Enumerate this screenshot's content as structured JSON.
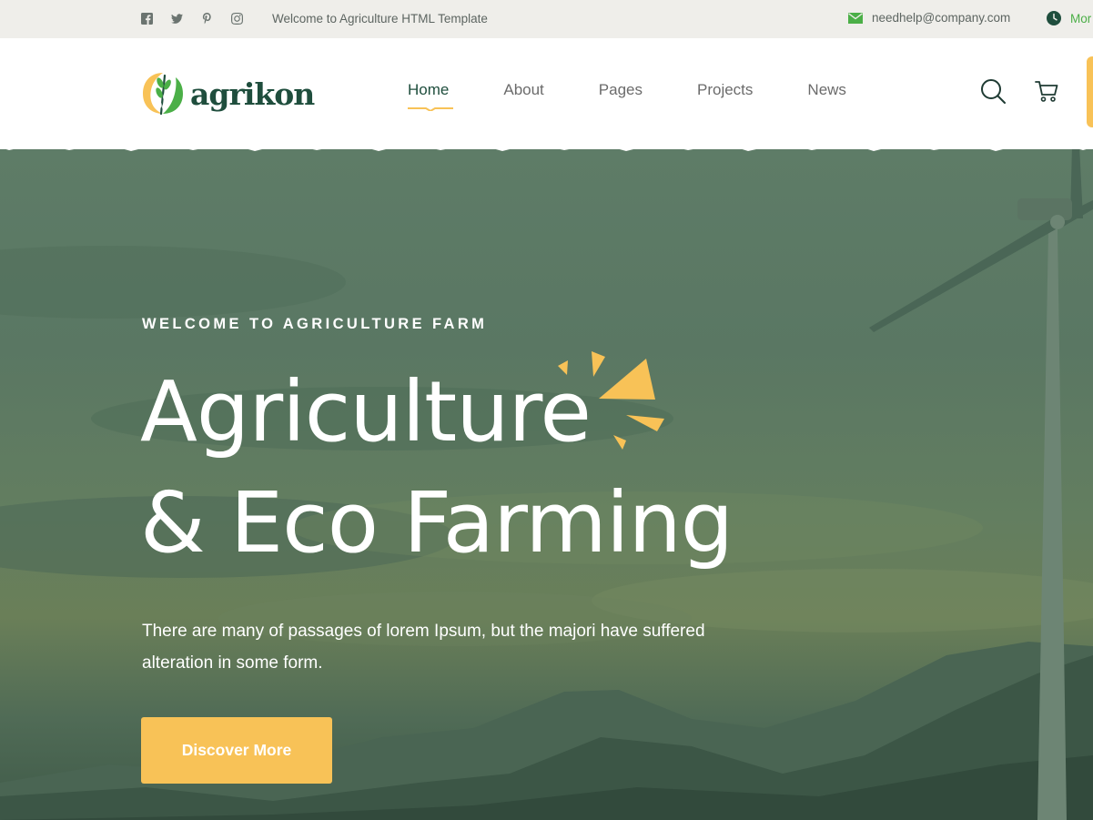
{
  "topbar": {
    "social_icons": [
      "facebook-icon",
      "twitter-icon",
      "pinterest-icon",
      "instagram-icon"
    ],
    "welcome": "Welcome to Agriculture HTML Template",
    "email": "needhelp@company.com",
    "hours_partial": "Mor"
  },
  "header": {
    "logo_text": "agrikon",
    "nav": [
      {
        "label": "Home",
        "active": true
      },
      {
        "label": "About",
        "active": false
      },
      {
        "label": "Pages",
        "active": false
      },
      {
        "label": "Projects",
        "active": false
      },
      {
        "label": "News",
        "active": false
      }
    ],
    "icons": [
      "search-icon",
      "cart-icon"
    ]
  },
  "hero": {
    "eyebrow": "WELCOME TO AGRICULTURE FARM",
    "headline_line1": "Agriculture",
    "headline_line2": "& Eco Farming",
    "description": "There are many of passages of lorem Ipsum, but the majori have suffered alteration in some form.",
    "cta_label": "Discover More"
  },
  "colors": {
    "brand_dark": "#1f4e3d",
    "accent_yellow": "#f8c257",
    "accent_green": "#4baf47",
    "hero_overlay": "#5e7c67",
    "topbar_bg": "#efeeea"
  }
}
